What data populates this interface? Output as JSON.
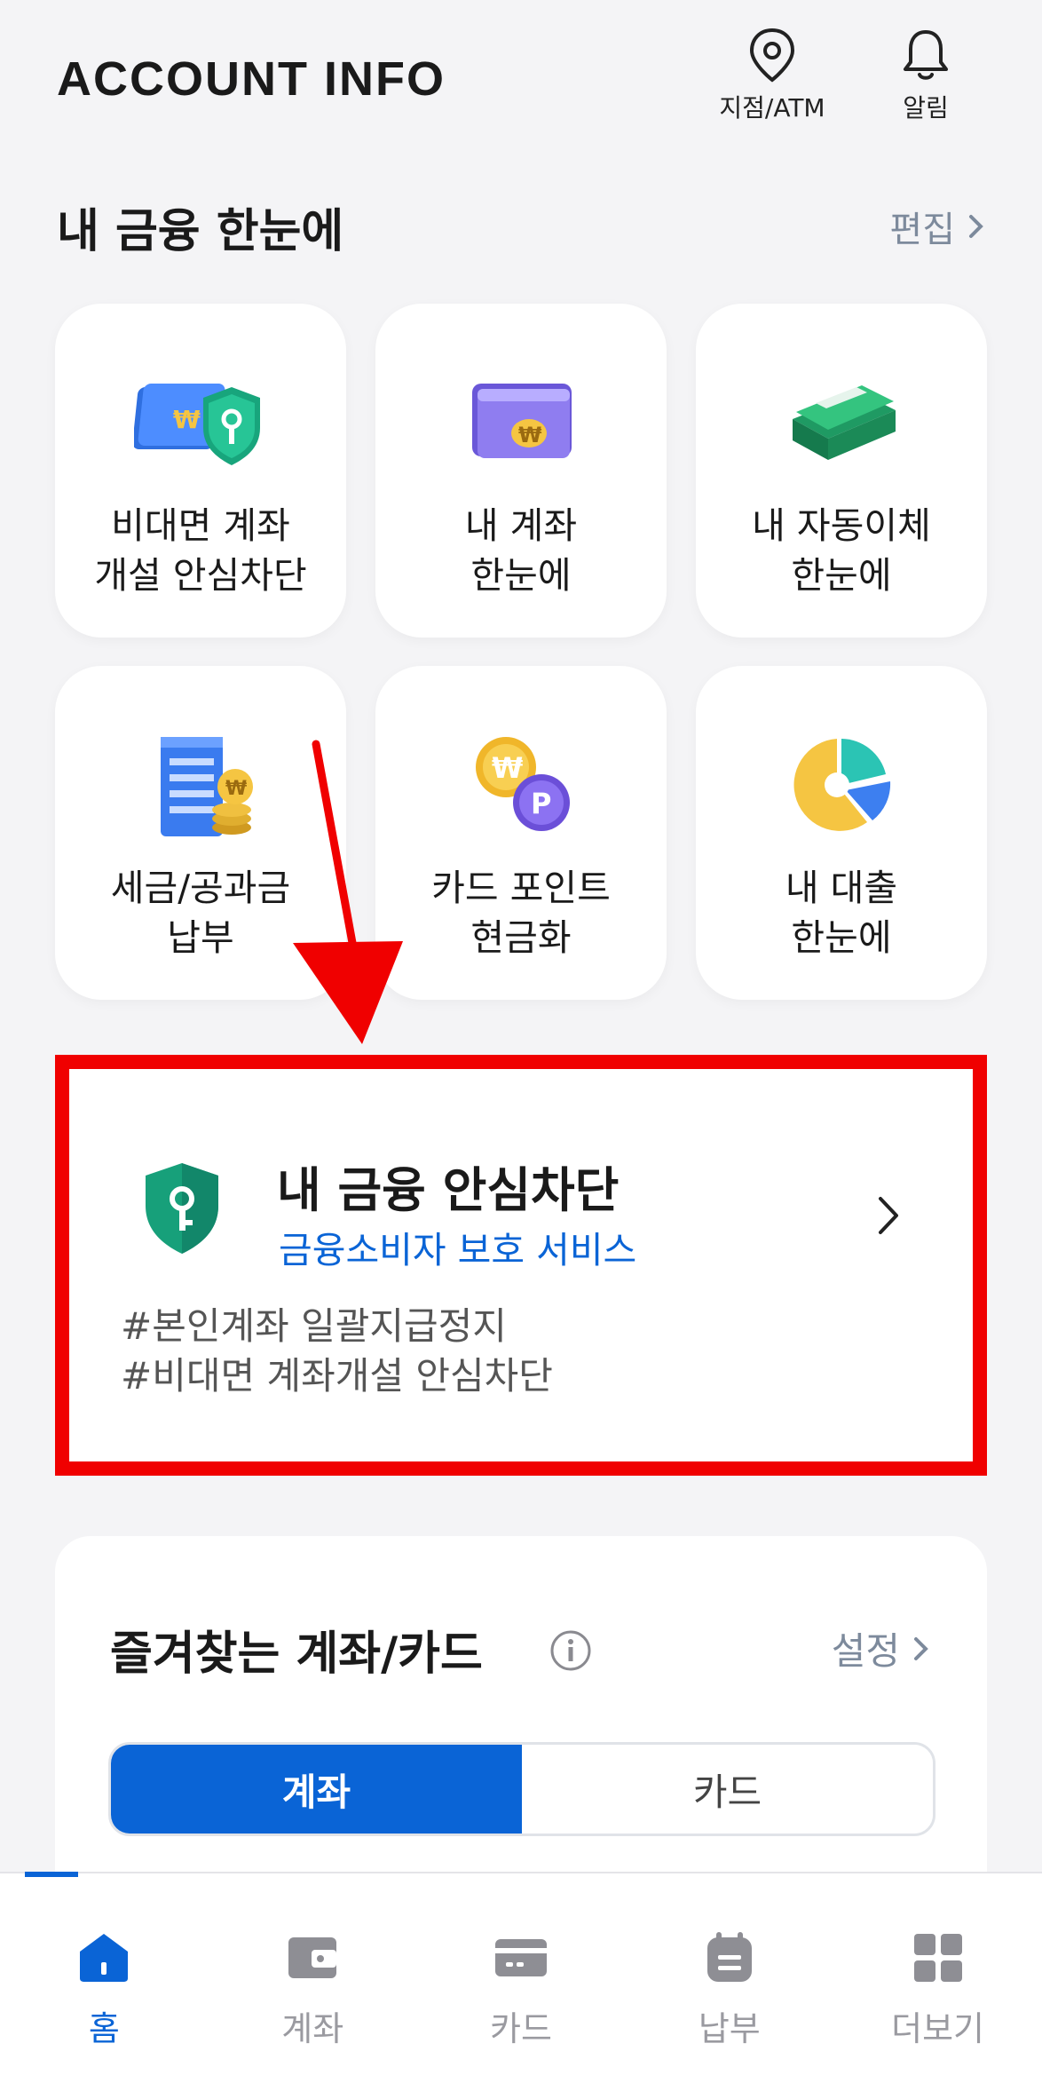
{
  "header": {
    "title": "ACCOUNT INFO",
    "atm_label": "지점/ATM",
    "alarm_label": "알림"
  },
  "my_finance": {
    "title": "내 금융 한눈에",
    "edit_label": "편집",
    "tiles": [
      {
        "label": "비대면 계좌\n개설 안심차단",
        "icon": "account-shield-icon"
      },
      {
        "label": "내 계좌\n한눈에",
        "icon": "bankbook-icon"
      },
      {
        "label": "내 자동이체\n한눈에",
        "icon": "cash-stack-icon"
      },
      {
        "label": "세금/공과금\n납부",
        "icon": "building-coins-icon"
      },
      {
        "label": "카드 포인트\n현금화",
        "icon": "won-point-coins-icon"
      },
      {
        "label": "내 대출\n한눈에",
        "icon": "pie-chart-icon"
      }
    ]
  },
  "safety_card": {
    "title": "내 금융 안심차단",
    "subtitle": "금융소비자 보호 서비스",
    "tags": [
      "#본인계좌 일괄지급정지",
      "#비대면 계좌개설 안심차단"
    ],
    "highlight_color": "#f00000"
  },
  "favorites": {
    "title": "즐겨찾는 계좌/카드",
    "settings_label": "설정",
    "tabs": [
      {
        "label": "계좌",
        "active": true
      },
      {
        "label": "카드",
        "active": false
      }
    ]
  },
  "bottom_nav": {
    "items": [
      {
        "label": "홈",
        "icon": "home-icon",
        "active": true
      },
      {
        "label": "계좌",
        "icon": "wallet-icon",
        "active": false
      },
      {
        "label": "카드",
        "icon": "card-icon",
        "active": false
      },
      {
        "label": "납부",
        "icon": "bill-icon",
        "active": false
      },
      {
        "label": "더보기",
        "icon": "grid-icon",
        "active": false
      }
    ]
  },
  "colors": {
    "accent": "#0a64d6",
    "background": "#f4f4f6",
    "muted_link": "#7d8a9c",
    "annotation_red": "#f00000"
  }
}
